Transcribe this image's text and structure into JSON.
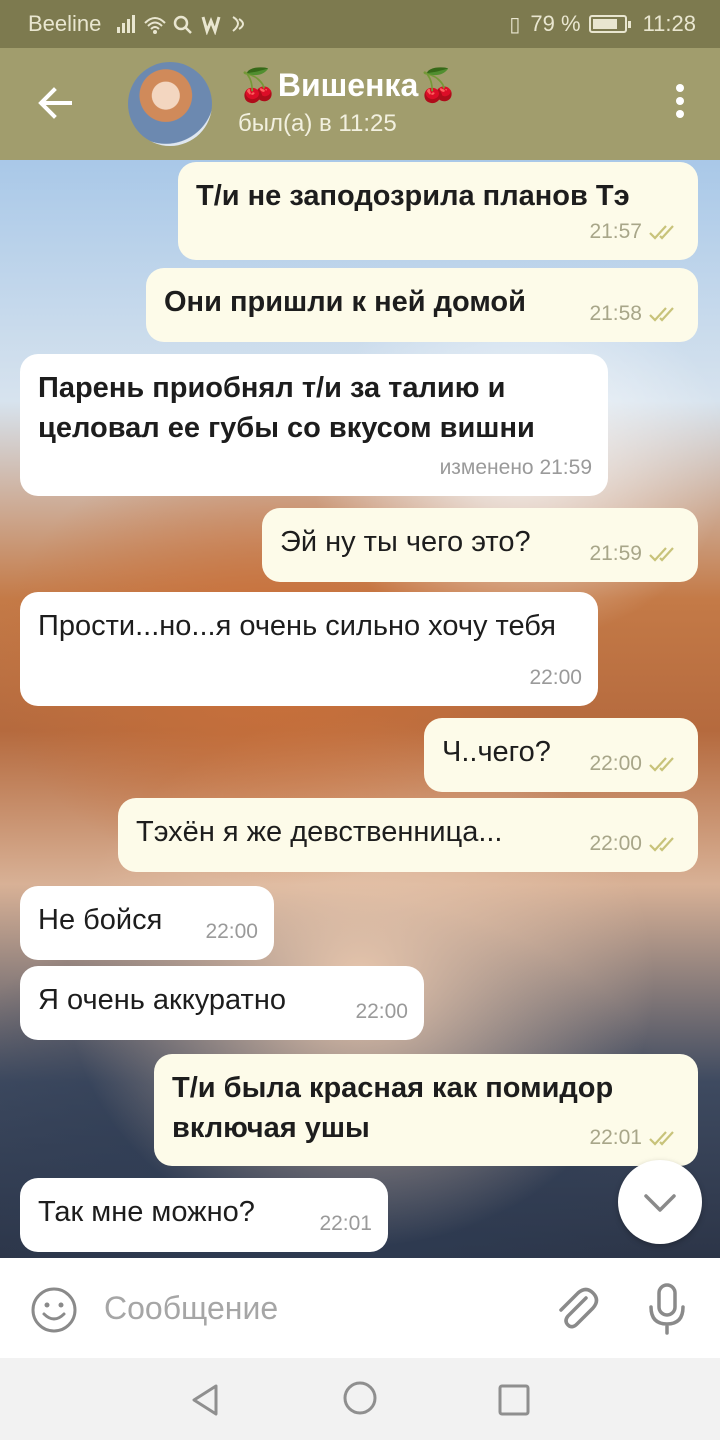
{
  "status_bar": {
    "carrier": "Beeline",
    "icons": "signal wifi search w nfc",
    "battery_percent": "79 %",
    "battery_level": 0.79,
    "time": "11:28"
  },
  "header": {
    "back_icon": "arrow-left-icon",
    "avatar": "contact-avatar",
    "title": "🍒Вишенка🍒",
    "status": "был(а) в 11:25",
    "menu_icon": "more-vertical-icon"
  },
  "messages": [
    {
      "dir": "out",
      "bold": true,
      "text": "Т/и не заподозрила планов Тэ",
      "time": "21:57",
      "read": true
    },
    {
      "dir": "out",
      "bold": true,
      "text": "Они пришли к ней домой",
      "time": "21:58",
      "read": true
    },
    {
      "dir": "in",
      "bold": true,
      "text": "Парень приобнял т/и за талию и целовал ее губы со вкусом вишни",
      "time": "изменено 21:59",
      "read": false
    },
    {
      "dir": "out",
      "bold": false,
      "text": "Эй ну ты чего это?",
      "time": "21:59",
      "read": true
    },
    {
      "dir": "in",
      "bold": false,
      "text": "Прости...но...я очень сильно хочу тебя",
      "time": "22:00",
      "read": false
    },
    {
      "dir": "out",
      "bold": false,
      "text": "Ч..чего?",
      "time": "22:00",
      "read": true
    },
    {
      "dir": "out",
      "bold": false,
      "text": "Тэхён я же девственница...",
      "time": "22:00",
      "read": true
    },
    {
      "dir": "in",
      "bold": false,
      "text": "Не бойся",
      "time": "22:00",
      "read": false
    },
    {
      "dir": "in",
      "bold": false,
      "text": "Я очень аккуратно",
      "time": "22:00",
      "read": false
    },
    {
      "dir": "out",
      "bold": true,
      "text": "Т/и была красная как помидор включая ушы",
      "time": "22:01",
      "read": true
    },
    {
      "dir": "in",
      "bold": false,
      "text": "Так мне можно?",
      "time": "22:01",
      "read": false
    }
  ],
  "scroll_down_icon": "chevron-down-icon",
  "input": {
    "emoji_icon": "smiley-icon",
    "placeholder": "Сообщение",
    "value": "",
    "attach_icon": "paperclip-icon",
    "mic_icon": "microphone-icon"
  },
  "nav": {
    "back_icon": "triangle-back-icon",
    "home_icon": "circle-home-icon",
    "recent_icon": "square-recent-icon"
  },
  "colors": {
    "header_bg": "#a19d6d",
    "status_bg": "#7d7a4f",
    "outgoing_bubble": "#fdfbe9",
    "incoming_bubble": "#ffffff",
    "read_ticks": "#c8c37a"
  }
}
